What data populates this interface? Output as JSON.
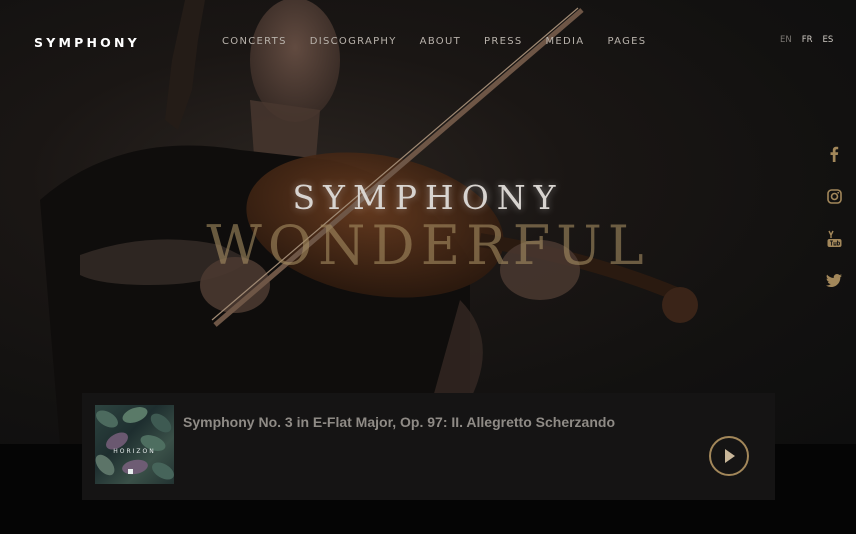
{
  "brand": {
    "logo": "SYMPHONY"
  },
  "nav": {
    "items": [
      "CONCERTS",
      "DISCOGRAPHY",
      "ABOUT",
      "PRESS",
      "MEDIA",
      "PAGES"
    ]
  },
  "languages": {
    "items": [
      "EN",
      "FR",
      "ES"
    ],
    "active": "EN"
  },
  "social": {
    "icons": [
      "facebook-icon",
      "instagram-icon",
      "youtube-icon",
      "twitter-icon"
    ]
  },
  "hero": {
    "title": "SYMPHONY",
    "subtitle": "WONDERFUL"
  },
  "player": {
    "album_title": "HORIZON",
    "track_title": "Symphony No. 3 in E-Flat Major, Op. 97: II. Allegretto Scherzando"
  },
  "colors": {
    "accent": "#a2875a",
    "background": "#0a0a0a",
    "player_bg": "#151414"
  }
}
